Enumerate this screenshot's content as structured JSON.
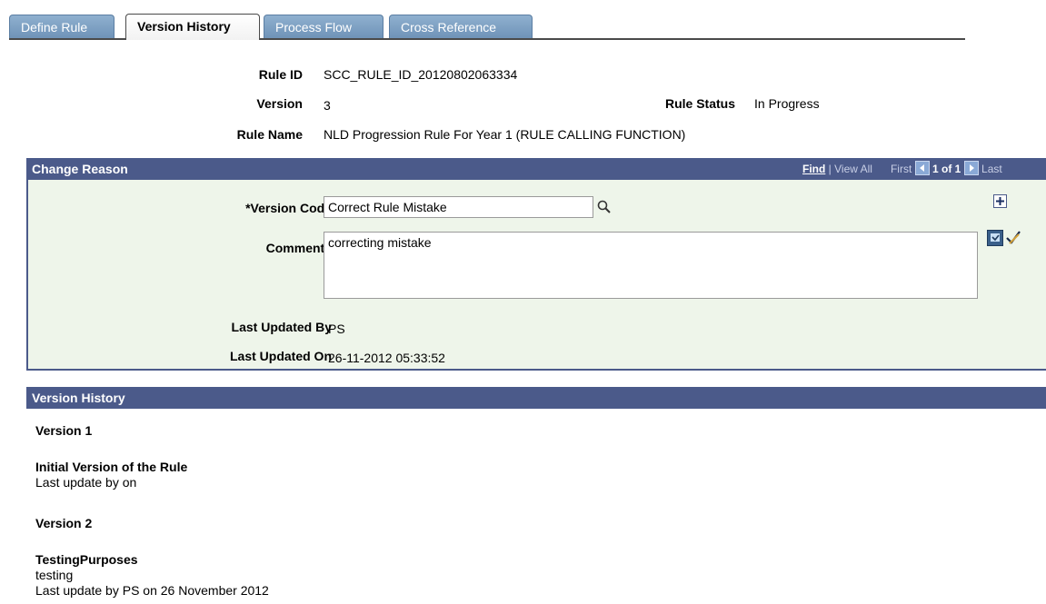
{
  "tabs": [
    {
      "label": "Define Rule",
      "active": false
    },
    {
      "label": "Version History",
      "active": true
    },
    {
      "label": "Process Flow",
      "active": false
    },
    {
      "label": "Cross Reference",
      "active": false
    }
  ],
  "header": {
    "rule_id_label": "Rule ID",
    "rule_id": "SCC_RULE_ID_20120802063334",
    "version_label": "Version",
    "version": "3",
    "rule_status_label": "Rule Status",
    "rule_status": "In Progress",
    "rule_name_label": "Rule Name",
    "rule_name": "NLD Progression Rule For Year 1 (RULE CALLING FUNCTION)"
  },
  "change_reason": {
    "title": "Change Reason",
    "find_label": "Find",
    "view_all_label": "View All",
    "first_label": "First",
    "page_info": "1 of 1",
    "last_label": "Last",
    "version_code_label": "*Version Code",
    "version_code": "Correct Rule Mistake",
    "comments_label": "Comments",
    "comments": "correcting mistake",
    "last_updated_by_label": "Last Updated By",
    "last_updated_by": "PS",
    "last_updated_on_label": "Last Updated On",
    "last_updated_on": "26-11-2012 05:33:52"
  },
  "version_history": {
    "title": "Version History",
    "entries": [
      {
        "version": "Version 1",
        "title": "Initial Version of the Rule",
        "comment": "",
        "updated": "Last update by on"
      },
      {
        "version": "Version 2",
        "title": "TestingPurposes",
        "comment": "testing",
        "updated": "Last update by PS on 26 November 2012"
      }
    ]
  },
  "colors": {
    "panel_header": "#4b5a8a",
    "panel_body": "#eef5ea",
    "tab": "#7a9cc0"
  }
}
